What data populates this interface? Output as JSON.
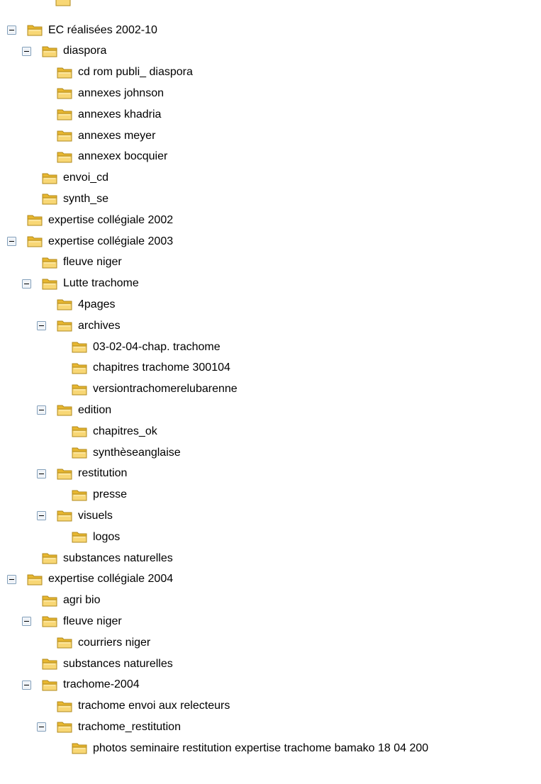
{
  "colors": {
    "folder_front": "#f8d775",
    "folder_back": "#e8b730",
    "folder_outline": "#b08a1c",
    "toggle_border": "#7f9db9",
    "toggle_fill": "#ffffff",
    "toggle_sign": "#000000",
    "text": "#000000",
    "background": "#ffffff"
  },
  "tree": {
    "nodes": [
      {
        "label": "EC réalisées 2002-10",
        "depth": 0,
        "expanded": true
      },
      {
        "label": "diaspora",
        "depth": 1,
        "expanded": true
      },
      {
        "label": "cd rom publi_ diaspora",
        "depth": 2,
        "expanded": false
      },
      {
        "label": "annexes johnson",
        "depth": 2,
        "expanded": false
      },
      {
        "label": "annexes khadria",
        "depth": 2,
        "expanded": false
      },
      {
        "label": "annexes meyer",
        "depth": 2,
        "expanded": false
      },
      {
        "label": "annexex bocquier",
        "depth": 2,
        "expanded": false
      },
      {
        "label": "envoi_cd",
        "depth": 1,
        "expanded": false
      },
      {
        "label": "synth_se",
        "depth": 1,
        "expanded": false
      },
      {
        "label": "expertise collégiale 2002",
        "depth": 0,
        "expanded": false
      },
      {
        "label": "expertise collégiale 2003",
        "depth": 0,
        "expanded": true
      },
      {
        "label": "fleuve niger",
        "depth": 1,
        "expanded": false
      },
      {
        "label": "Lutte trachome",
        "depth": 1,
        "expanded": true
      },
      {
        "label": "4pages",
        "depth": 2,
        "expanded": false
      },
      {
        "label": "archives",
        "depth": 2,
        "expanded": true
      },
      {
        "label": "03-02-04-chap. trachome",
        "depth": 3,
        "expanded": false
      },
      {
        "label": "chapitres trachome 300104",
        "depth": 3,
        "expanded": false
      },
      {
        "label": "versiontrachomerelubarenne",
        "depth": 3,
        "expanded": false
      },
      {
        "label": "edition",
        "depth": 2,
        "expanded": true
      },
      {
        "label": "chapitres_ok",
        "depth": 3,
        "expanded": false
      },
      {
        "label": "synthèseanglaise",
        "depth": 3,
        "expanded": false
      },
      {
        "label": "restitution",
        "depth": 2,
        "expanded": true
      },
      {
        "label": "presse",
        "depth": 3,
        "expanded": false
      },
      {
        "label": "visuels",
        "depth": 2,
        "expanded": true
      },
      {
        "label": "logos",
        "depth": 3,
        "expanded": false
      },
      {
        "label": "substances naturelles",
        "depth": 1,
        "expanded": false
      },
      {
        "label": "expertise collégiale 2004",
        "depth": 0,
        "expanded": true
      },
      {
        "label": "agri bio",
        "depth": 1,
        "expanded": false
      },
      {
        "label": "fleuve niger",
        "depth": 1,
        "expanded": true
      },
      {
        "label": "courriers niger",
        "depth": 2,
        "expanded": false
      },
      {
        "label": "substances naturelles",
        "depth": 1,
        "expanded": false
      },
      {
        "label": "trachome-2004",
        "depth": 1,
        "expanded": true
      },
      {
        "label": "trachome envoi aux relecteurs",
        "depth": 2,
        "expanded": false
      },
      {
        "label": "trachome_restitution",
        "depth": 2,
        "expanded": true
      },
      {
        "label": "photos seminaire restitution expertise trachome bamako 18 04 200",
        "depth": 3,
        "expanded": false
      }
    ]
  }
}
